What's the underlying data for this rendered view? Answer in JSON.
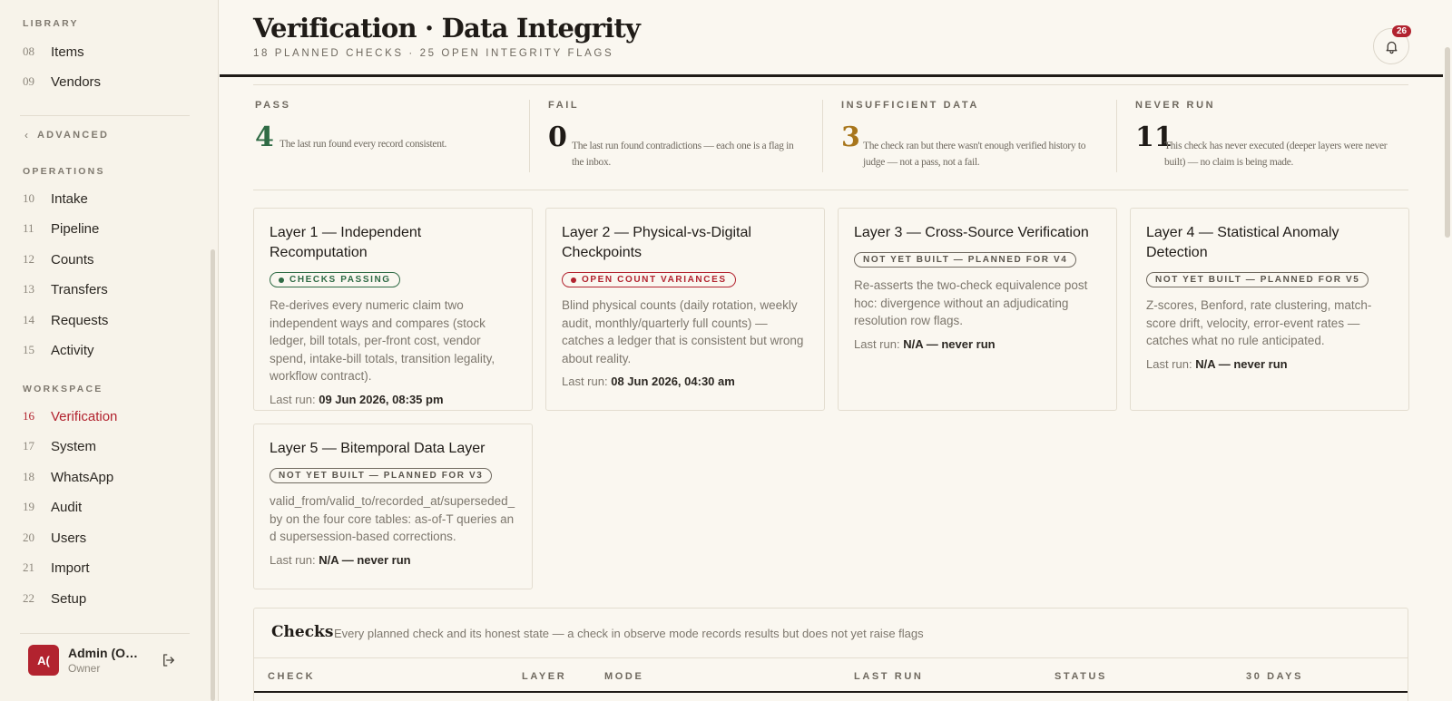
{
  "sidebar": {
    "library": {
      "label": "LIBRARY",
      "items": [
        {
          "num": "08",
          "label": "Items"
        },
        {
          "num": "09",
          "label": "Vendors"
        }
      ]
    },
    "advanced_label": "ADVANCED",
    "operations": {
      "label": "OPERATIONS",
      "items": [
        {
          "num": "10",
          "label": "Intake"
        },
        {
          "num": "11",
          "label": "Pipeline"
        },
        {
          "num": "12",
          "label": "Counts"
        },
        {
          "num": "13",
          "label": "Transfers"
        },
        {
          "num": "14",
          "label": "Requests"
        },
        {
          "num": "15",
          "label": "Activity"
        }
      ]
    },
    "workspace": {
      "label": "WORKSPACE",
      "items": [
        {
          "num": "16",
          "label": "Verification",
          "active": true
        },
        {
          "num": "17",
          "label": "System"
        },
        {
          "num": "18",
          "label": "WhatsApp"
        },
        {
          "num": "19",
          "label": "Audit"
        },
        {
          "num": "20",
          "label": "Users"
        },
        {
          "num": "21",
          "label": "Import"
        },
        {
          "num": "22",
          "label": "Setup"
        }
      ]
    },
    "user": {
      "initials": "A(",
      "name": "Admin (Owner)",
      "role": "Owner"
    }
  },
  "header": {
    "title": "Verification · Data Integrity",
    "subtitle": "18 PLANNED CHECKS · 25 OPEN INTEGRITY FLAGS",
    "notification_count": "26"
  },
  "stats": [
    {
      "label": "PASS",
      "value": "4",
      "color": "#2f6b45",
      "desc": "The last run found every record consistent."
    },
    {
      "label": "FAIL",
      "value": "0",
      "color": "#1f1b17",
      "desc": "The last run found contradictions — each one is a flag in the inbox."
    },
    {
      "label": "INSUFFICIENT DATA",
      "value": "3",
      "color": "#a8761c",
      "desc": "The check ran but there wasn't enough verified history to judge — not a pass, not a fail."
    },
    {
      "label": "NEVER RUN",
      "value": "11",
      "color": "#1f1b17",
      "desc": "This check has never executed (deeper layers were never built) — no claim is being made."
    }
  ],
  "layers": [
    {
      "title": "Layer 1 — Independent Recomputation",
      "badge": "CHECKS PASSING",
      "status": "green",
      "desc": "Re-derives every numeric claim two independent ways and compares (stock ledger, bill totals, per-front cost, vendor spend, intake-bill totals, transition legality, workflow contract).",
      "last_run_label": "Last run:",
      "last_run": "09 Jun 2026, 08:35 pm"
    },
    {
      "title": "Layer 2 — Physical-vs-Digital Checkpoints",
      "badge": "OPEN COUNT VARIANCES",
      "status": "red",
      "desc": "Blind physical counts (daily rotation, weekly audit, monthly/quarterly full counts) — catches a ledger that is consistent but wrong about reality.",
      "last_run_label": "Last run:",
      "last_run": "08 Jun 2026, 04:30 am"
    },
    {
      "title": "Layer 3 — Cross-Source Verification",
      "badge": "NOT YET BUILT — PLANNED FOR V4",
      "status": "gray",
      "desc": "Re-asserts the two-check equivalence post hoc: divergence without an adjudicating resolution row flags.",
      "last_run_label": "Last run:",
      "last_run": "N/A — never run"
    },
    {
      "title": "Layer 4 — Statistical Anomaly Detection",
      "badge": "NOT YET BUILT — PLANNED FOR V5",
      "status": "gray",
      "desc": "Z-scores, Benford, rate clustering, match-score drift, velocity, error-event rates — catches what no rule anticipated.",
      "last_run_label": "Last run:",
      "last_run": "N/A — never run"
    },
    {
      "title": "Layer 5 — Bitemporal Data Layer",
      "badge": "NOT YET BUILT — PLANNED FOR V3",
      "status": "gray",
      "desc": "valid_from/valid_to/recorded_at/superseded_by on the four core tables: as-of-T queries and supersession-based corrections.",
      "last_run_label": "Last run:",
      "last_run": "N/A — never run"
    }
  ],
  "checks": {
    "title": "Checks",
    "subtitle": "Every planned check and its honest state — a check in observe mode records results but does not yet raise flags",
    "columns": [
      "CHECK",
      "LAYER",
      "MODE",
      "LAST RUN",
      "STATUS",
      "30 DAYS"
    ]
  }
}
